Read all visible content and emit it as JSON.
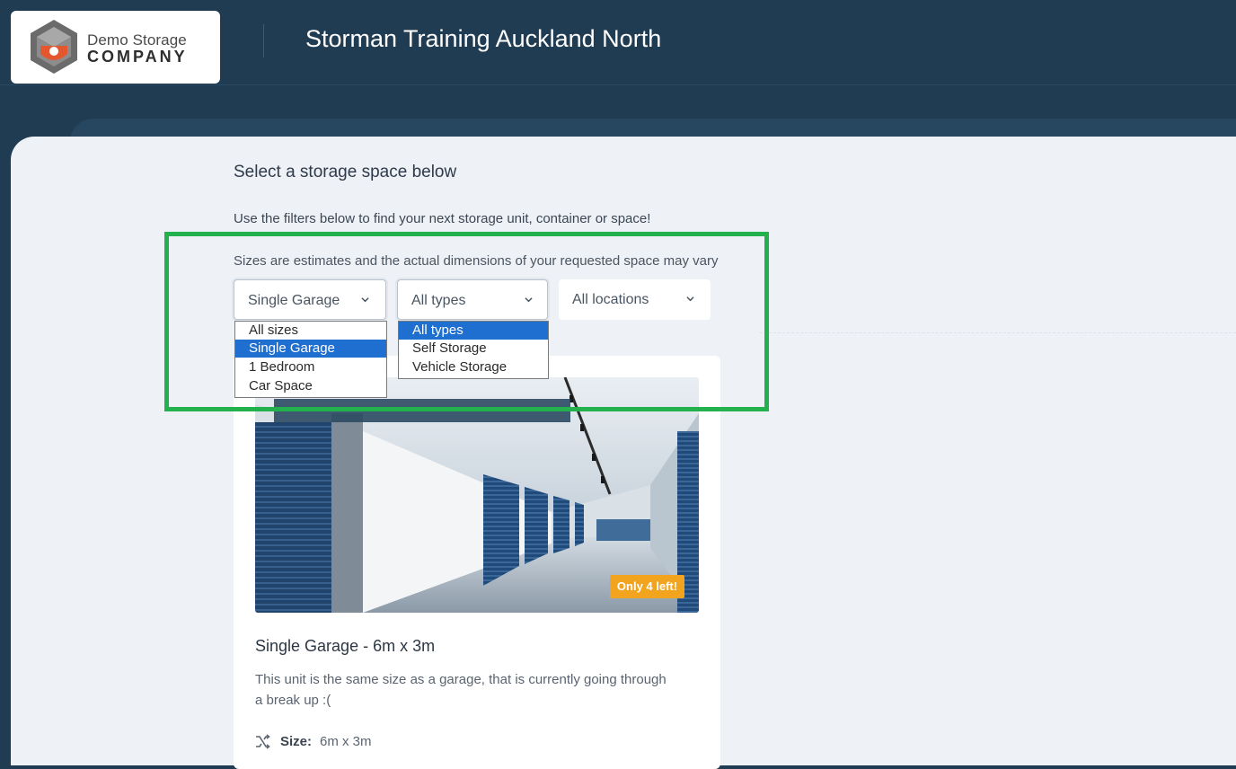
{
  "header": {
    "logo": {
      "line1": "Demo Storage",
      "line2": "COMPANY",
      "icon": "hexagon-shield-logo-icon"
    },
    "title": "Storman Training Auckland North"
  },
  "main": {
    "heading": "Select a storage space below",
    "subtext": "Use the filters below to find your next storage unit, container or space!",
    "note": "Sizes are estimates and the actual dimensions of your requested space may vary"
  },
  "filters": {
    "size": {
      "selected": "Single Garage",
      "options": [
        "All sizes",
        "Single Garage",
        "1 Bedroom",
        "Car Space"
      ],
      "highlighted": "Single Garage"
    },
    "type": {
      "selected": "All types",
      "options": [
        "All types",
        "Self Storage",
        "Vehicle Storage"
      ],
      "highlighted": "All types"
    },
    "location": {
      "selected": "All locations"
    }
  },
  "card": {
    "badge": "Only 4 left!",
    "title": "Single Garage - 6m x 3m",
    "description": "This unit is the same size as a garage, that is currently going through a break up :(",
    "size_label": "Size:",
    "size_value": "6m x 3m",
    "size_icon": "shuffle-arrows-icon"
  },
  "colors": {
    "header_bg": "#1f3c52",
    "panel_bg": "#eef1f6",
    "option_selected": "#1f6fd1",
    "badge": "#f3a41f",
    "highlight_box": "#22b14c"
  }
}
